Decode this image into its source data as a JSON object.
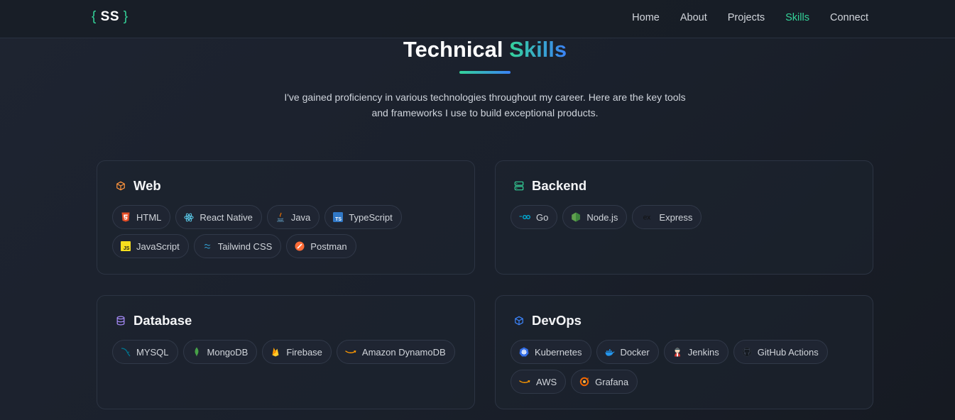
{
  "nav": {
    "logo_left": "{",
    "logo_text": "SS",
    "logo_right": "}",
    "links": [
      "Home",
      "About",
      "Projects",
      "Skills",
      "Connect"
    ],
    "active": "Skills"
  },
  "header": {
    "title_main": "Technical",
    "title_accent": "Skills",
    "subtitle_line1": "I've gained proficiency in various technologies throughout my career. Here are the key tools",
    "subtitle_line2": "and frameworks I use to build exceptional products."
  },
  "categories": [
    {
      "name": "Web",
      "icon": "cube-icon",
      "color": "#fb923c",
      "skills": [
        {
          "label": "HTML",
          "icon": "html5-icon"
        },
        {
          "label": "React Native",
          "icon": "react-icon"
        },
        {
          "label": "Java",
          "icon": "java-icon"
        },
        {
          "label": "TypeScript",
          "icon": "typescript-icon"
        },
        {
          "label": "JavaScript",
          "icon": "javascript-icon"
        },
        {
          "label": "Tailwind CSS",
          "icon": "tailwind-icon"
        },
        {
          "label": "Postman",
          "icon": "postman-icon"
        }
      ]
    },
    {
      "name": "Backend",
      "icon": "server-icon",
      "color": "#34d399",
      "skills": [
        {
          "label": "Go",
          "icon": "go-icon"
        },
        {
          "label": "Node.js",
          "icon": "nodejs-icon"
        },
        {
          "label": "Express",
          "icon": "express-icon"
        }
      ]
    },
    {
      "name": "Database",
      "icon": "database-icon",
      "color": "#a78bfa",
      "skills": [
        {
          "label": "MYSQL",
          "icon": "mysql-icon"
        },
        {
          "label": "MongoDB",
          "icon": "mongodb-icon"
        },
        {
          "label": "Firebase",
          "icon": "firebase-icon"
        },
        {
          "label": "Amazon DynamoDB",
          "icon": "amazon-icon"
        }
      ]
    },
    {
      "name": "DevOps",
      "icon": "box-icon",
      "color": "#3b82f6",
      "skills": [
        {
          "label": "Kubernetes",
          "icon": "kubernetes-icon"
        },
        {
          "label": "Docker",
          "icon": "docker-icon"
        },
        {
          "label": "Jenkins",
          "icon": "jenkins-icon"
        },
        {
          "label": "GitHub Actions",
          "icon": "github-icon"
        },
        {
          "label": "AWS",
          "icon": "aws-icon"
        },
        {
          "label": "Grafana",
          "icon": "grafana-icon"
        }
      ]
    }
  ]
}
